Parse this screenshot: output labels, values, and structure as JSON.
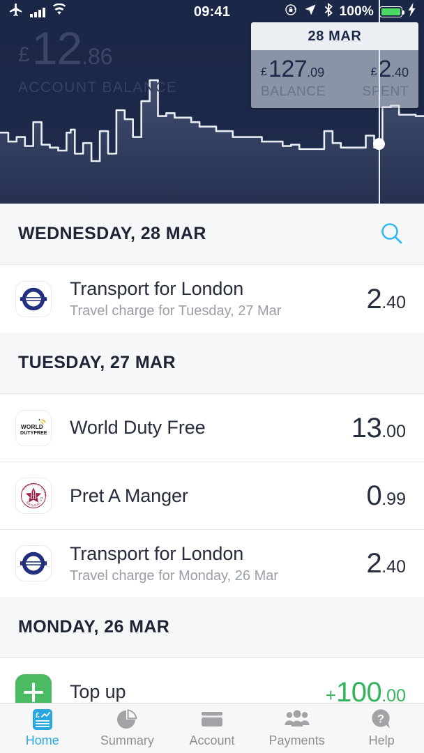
{
  "status_bar": {
    "airplane_icon": "airplane-icon",
    "signal_icon": "signal-bars-icon",
    "wifi_icon": "wifi-icon",
    "time": "09:41",
    "rotation_lock_icon": "rotation-lock-icon",
    "location_icon": "location-arrow-icon",
    "bluetooth_icon": "bluetooth-icon",
    "battery_percent": "100%",
    "battery_icon": "battery-full-icon",
    "charging_icon": "lightning-bolt-icon"
  },
  "header": {
    "currency": "£",
    "balance_int": "12",
    "balance_dec": ".86",
    "balance_label": "ACCOUNT BALANCE",
    "background_color": "#1c2847",
    "chart_line_color": "#e9edf5"
  },
  "popover": {
    "date": "28 MAR",
    "balance": {
      "currency": "£",
      "int": "127",
      "dec": ".09",
      "label": "BALANCE"
    },
    "spent": {
      "currency": "£",
      "int": "2",
      "dec": ".40",
      "label": "SPENT"
    }
  },
  "search": {
    "icon": "search-icon",
    "color": "#35b8ef"
  },
  "sections": [
    {
      "title": "WEDNESDAY, 28 MAR",
      "has_search": true,
      "transactions": [
        {
          "logo": "tfl-roundel-logo",
          "name": "Transport for London",
          "subtitle": "Travel charge for Tuesday, 27 Mar",
          "sign": "",
          "amount_int": "2",
          "amount_dec": ".40",
          "credit": false
        }
      ]
    },
    {
      "title": "TUESDAY, 27 MAR",
      "has_search": false,
      "transactions": [
        {
          "logo": "world-duty-free-logo",
          "name": "World Duty Free",
          "subtitle": "",
          "sign": "",
          "amount_int": "13",
          "amount_dec": ".00",
          "credit": false
        },
        {
          "logo": "pret-a-manger-logo",
          "name": "Pret A Manger",
          "subtitle": "",
          "sign": "",
          "amount_int": "0",
          "amount_dec": ".99",
          "credit": false
        },
        {
          "logo": "tfl-roundel-logo",
          "name": "Transport for London",
          "subtitle": "Travel charge for Monday, 26 Mar",
          "sign": "",
          "amount_int": "2",
          "amount_dec": ".40",
          "credit": false
        }
      ]
    },
    {
      "title": "MONDAY, 26 MAR",
      "has_search": false,
      "transactions": [
        {
          "logo": "plus-topup-icon",
          "name": "Top up",
          "subtitle": "",
          "sign": "+",
          "amount_int": "100",
          "amount_dec": ".00",
          "credit": true
        }
      ]
    }
  ],
  "tabbar": {
    "active_color": "#2aa7e0",
    "inactive_color": "#8e8e93",
    "items": [
      {
        "label": "Home",
        "icon": "home-statement-icon",
        "active": true
      },
      {
        "label": "Summary",
        "icon": "pie-chart-icon",
        "active": false
      },
      {
        "label": "Account",
        "icon": "credit-card-icon",
        "active": false
      },
      {
        "label": "Payments",
        "icon": "people-group-icon",
        "active": false
      },
      {
        "label": "Help",
        "icon": "help-question-bubble-icon",
        "active": false
      }
    ]
  },
  "chart_data": {
    "type": "line",
    "title": "Account balance history",
    "xlabel": "",
    "ylabel": "Balance",
    "grid": false,
    "legend": null,
    "marker": {
      "x_index": 63,
      "label": "28 MAR",
      "balance": 127.09,
      "spent": 2.4
    },
    "values": [
      78,
      78,
      66,
      66,
      72,
      72,
      60,
      60,
      92,
      92,
      62,
      62,
      58,
      58,
      54,
      54,
      78,
      82,
      50,
      50,
      64,
      64,
      40,
      40,
      80,
      80,
      50,
      50,
      108,
      108,
      96,
      96,
      72,
      72,
      120,
      120,
      148,
      148,
      100,
      100,
      104,
      104,
      98,
      98,
      98,
      98,
      92,
      92,
      86,
      86,
      86,
      86,
      80,
      80,
      80,
      80,
      72,
      72,
      72,
      72,
      72,
      72,
      72,
      66,
      66,
      66,
      66,
      66,
      60,
      60,
      62,
      62,
      56,
      56,
      56,
      56,
      56,
      56,
      80,
      80,
      64,
      64,
      58,
      58,
      58,
      58,
      58,
      58,
      74,
      74,
      58,
      58,
      112,
      112,
      114,
      114,
      102,
      102,
      102,
      102,
      100,
      100,
      100
    ]
  }
}
